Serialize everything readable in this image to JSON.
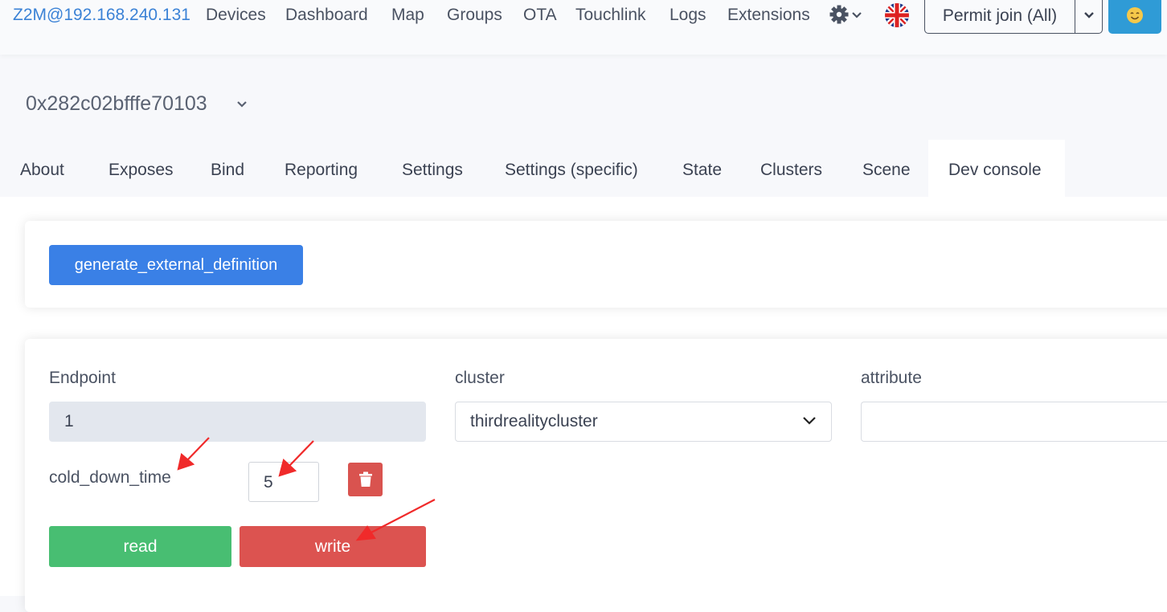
{
  "navbar": {
    "brand": "Z2M@192.168.240.131",
    "links": [
      "Devices",
      "Dashboard",
      "Map",
      "Groups",
      "OTA",
      "Touchlink",
      "Logs",
      "Extensions"
    ],
    "permit_join_label": "Permit join (All)",
    "user_icon": "smiley-face-icon"
  },
  "device": {
    "title": "0x282c02bfffe70103"
  },
  "tabs": [
    "About",
    "Exposes",
    "Bind",
    "Reporting",
    "Settings",
    "Settings (specific)",
    "State",
    "Clusters",
    "Scene",
    "Dev console"
  ],
  "active_tab": "Dev console",
  "dev_console": {
    "generate_button": "generate_external_definition",
    "endpoint_label": "Endpoint",
    "endpoint_value": "1",
    "cluster_label": "cluster",
    "cluster_value": "thirdrealitycluster",
    "attribute_label": "attribute",
    "attribute_value": "",
    "attribute_name": "cold_down_time",
    "attribute_input_value": "5",
    "read_button": "read",
    "write_button": "write"
  },
  "colors": {
    "primary": "#3a80e6",
    "success": "#48be72",
    "danger": "#dc5350",
    "annotation_arrow": "#f02a2a"
  }
}
